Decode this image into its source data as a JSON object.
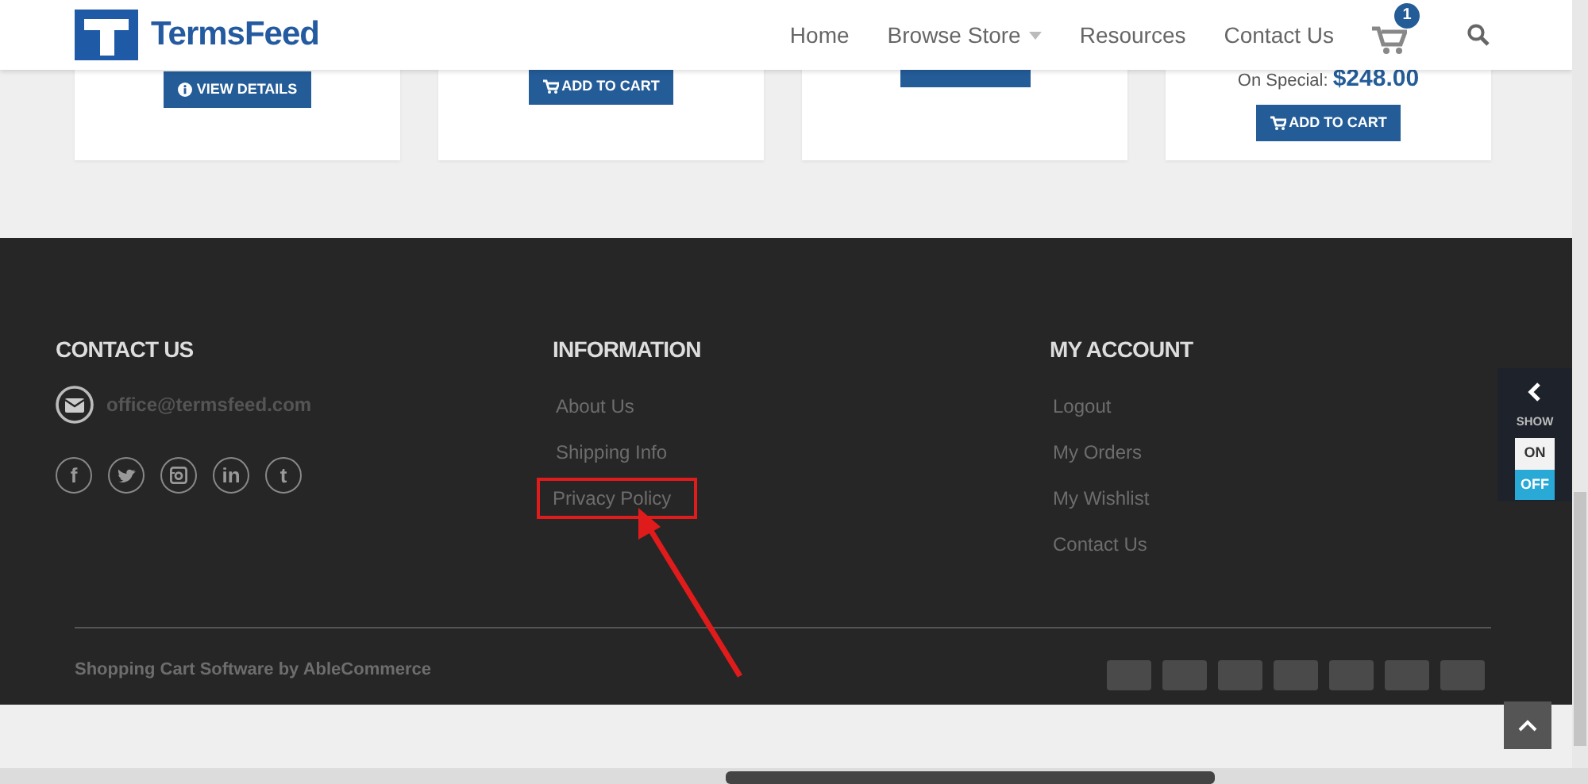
{
  "header": {
    "logo": "TermsFeed",
    "nav": [
      {
        "label": "Home",
        "dropdown": false
      },
      {
        "label": "Browse Store",
        "dropdown": true
      },
      {
        "label": "Resources",
        "dropdown": false
      },
      {
        "label": "Contact Us",
        "dropdown": false
      }
    ],
    "cart_count": "1"
  },
  "products": [
    {
      "button": "VIEW DETAILS",
      "kind": "details"
    },
    {
      "button": "ADD TO CART",
      "kind": "cart"
    },
    {
      "kind": "cut"
    },
    {
      "price_label": "On Special:",
      "price": "$248.00",
      "button": "ADD TO CART",
      "kind": "cart"
    }
  ],
  "footer": {
    "contact": {
      "title": "CONTACT US",
      "email": "office@termsfeed.com",
      "social": [
        {
          "kind": "facebook",
          "glyph": "f"
        },
        {
          "kind": "twitter"
        },
        {
          "kind": "instagram"
        },
        {
          "kind": "linkedin",
          "glyph": "in"
        },
        {
          "kind": "tumblr",
          "glyph": "t"
        }
      ]
    },
    "columns": [
      {
        "title": "INFORMATION",
        "links": [
          {
            "label": "About Us",
            "highlighted": false
          },
          {
            "label": "Shipping Info",
            "highlighted": false
          },
          {
            "label": "Privacy Policy",
            "highlighted": true
          }
        ]
      },
      {
        "title": "MY ACCOUNT",
        "links": [
          {
            "label": "Logout",
            "highlighted": false
          },
          {
            "label": "My Orders",
            "highlighted": false
          },
          {
            "label": "My Wishlist",
            "highlighted": false
          },
          {
            "label": "Contact Us",
            "highlighted": false
          }
        ]
      }
    ],
    "copyright": "Shopping Cart Software by AbleCommerce"
  },
  "side_widget": {
    "label": "SHOW",
    "options": [
      {
        "label": "ON",
        "selected": false
      },
      {
        "label": "OFF",
        "selected": true
      }
    ]
  }
}
